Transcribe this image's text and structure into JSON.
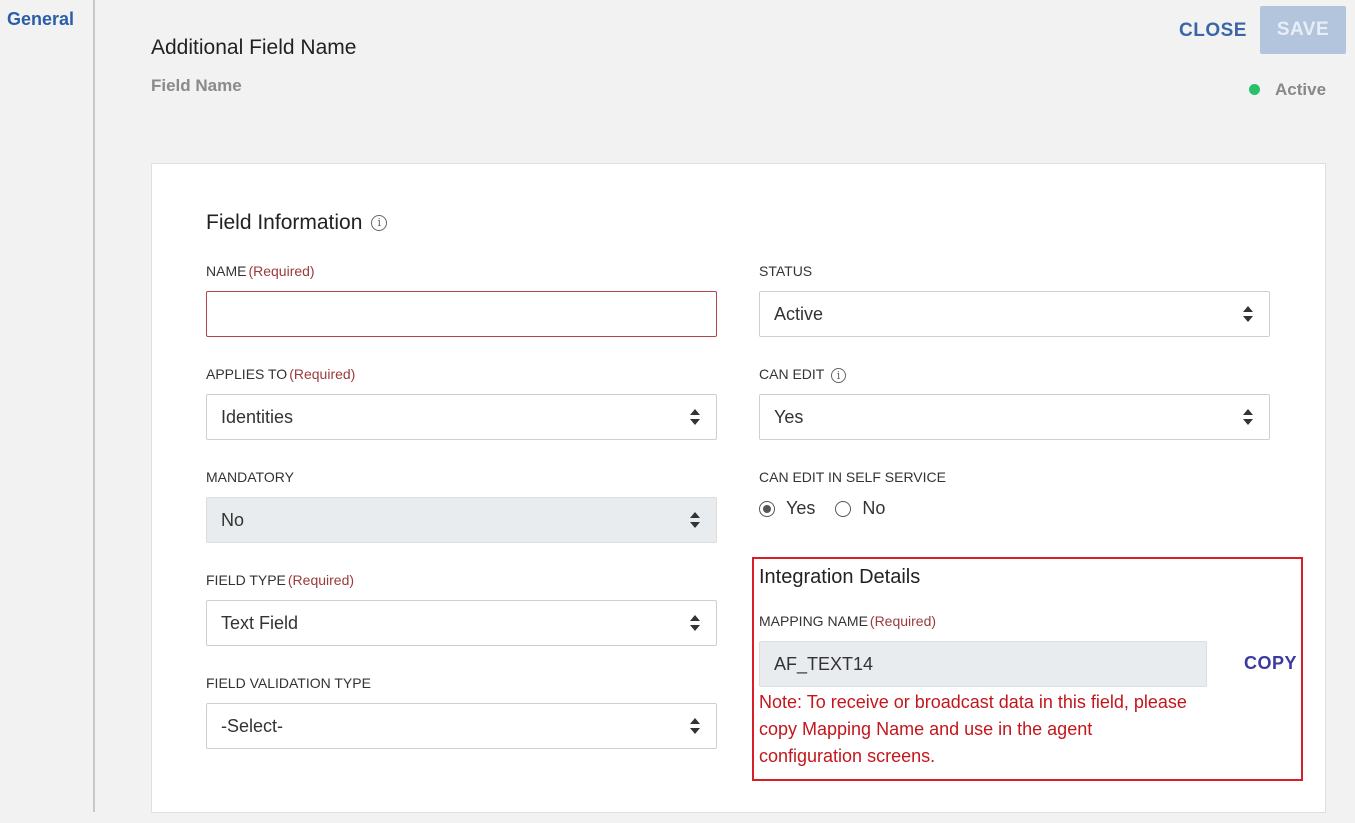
{
  "sidebar": {
    "items": [
      {
        "label": "General"
      }
    ]
  },
  "header": {
    "title": "Additional Field Name",
    "subtitle": "Field Name",
    "close_label": "CLOSE",
    "save_label": "SAVE",
    "status": "Active",
    "status_color": "#27c06b"
  },
  "field_info": {
    "title": "Field Information",
    "required_text": "(Required)",
    "name": {
      "label": "NAME",
      "value": ""
    },
    "status": {
      "label": "STATUS",
      "value": "Active"
    },
    "applies_to": {
      "label": "APPLIES TO",
      "value": "Identities"
    },
    "can_edit": {
      "label": "CAN EDIT",
      "value": "Yes"
    },
    "mandatory": {
      "label": "MANDATORY",
      "value": "No"
    },
    "can_edit_self_service": {
      "label": "CAN EDIT IN SELF SERVICE",
      "options": [
        "Yes",
        "No"
      ],
      "selected": "Yes"
    },
    "field_type": {
      "label": "FIELD TYPE",
      "value": "Text Field"
    },
    "field_validation_type": {
      "label": "FIELD VALIDATION TYPE",
      "value": "-Select-"
    }
  },
  "integration": {
    "title": "Integration Details",
    "mapping_name": {
      "label": "MAPPING NAME",
      "value": "AF_TEXT14"
    },
    "copy_label": "COPY",
    "note": "Note: To receive or broadcast data in this field, please copy Mapping Name and use in the agent configuration screens."
  },
  "colors": {
    "accent": "#2a5fa5",
    "required": "#9b3a3a",
    "highlight": "#d81e27",
    "note": "#c3161c"
  }
}
